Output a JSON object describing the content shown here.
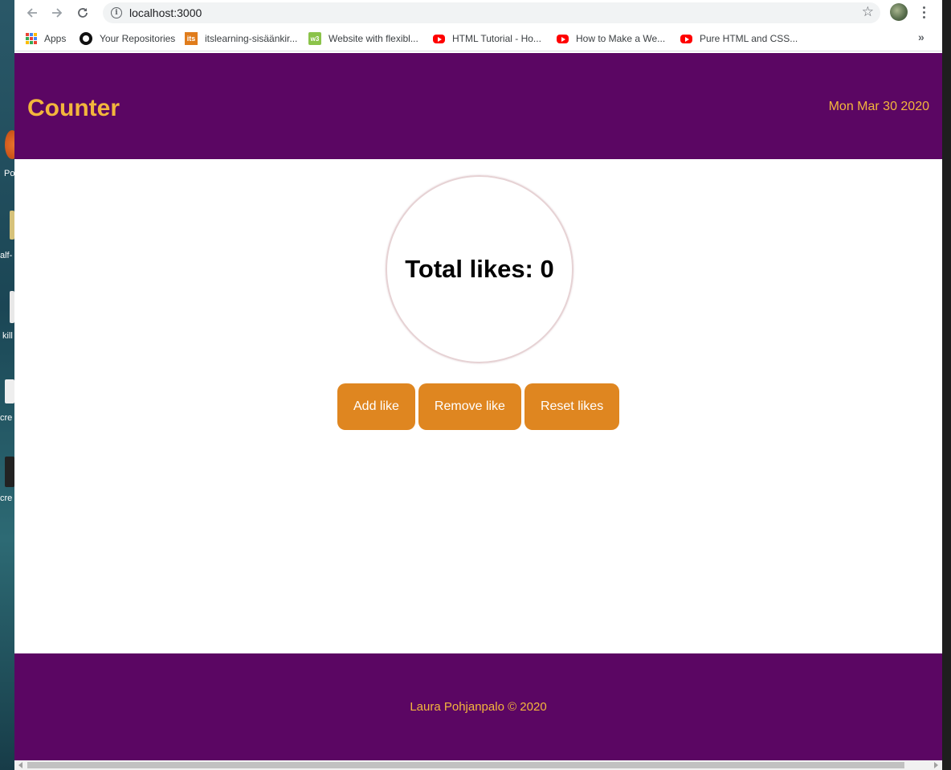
{
  "browser": {
    "url": "localhost:3000",
    "bookmarks": [
      {
        "label": "Apps",
        "icon": "apps-grid-icon"
      },
      {
        "label": "Your Repositories",
        "icon": "github-icon"
      },
      {
        "label": "itslearning-sisäänkir...",
        "icon": "itslearning-icon"
      },
      {
        "label": "Website with flexibl...",
        "icon": "w3schools-icon"
      },
      {
        "label": "HTML Tutorial - Ho...",
        "icon": "youtube-icon"
      },
      {
        "label": "How to Make a We...",
        "icon": "youtube-icon"
      },
      {
        "label": "Pure HTML and CSS...",
        "icon": "youtube-icon"
      }
    ],
    "bookmarks_overflow": "»"
  },
  "site": {
    "title": "Counter",
    "date": "Mon Mar 30 2020",
    "total_likes": "Total likes: 0",
    "buttons": {
      "add": "Add like",
      "remove": "Remove like",
      "reset": "Reset likes"
    },
    "footer": "Laura Pohjanpalo © 2020"
  },
  "colors": {
    "header_bg": "#5b0663",
    "accent_text": "#f3b63c",
    "button_bg": "#df8620"
  }
}
